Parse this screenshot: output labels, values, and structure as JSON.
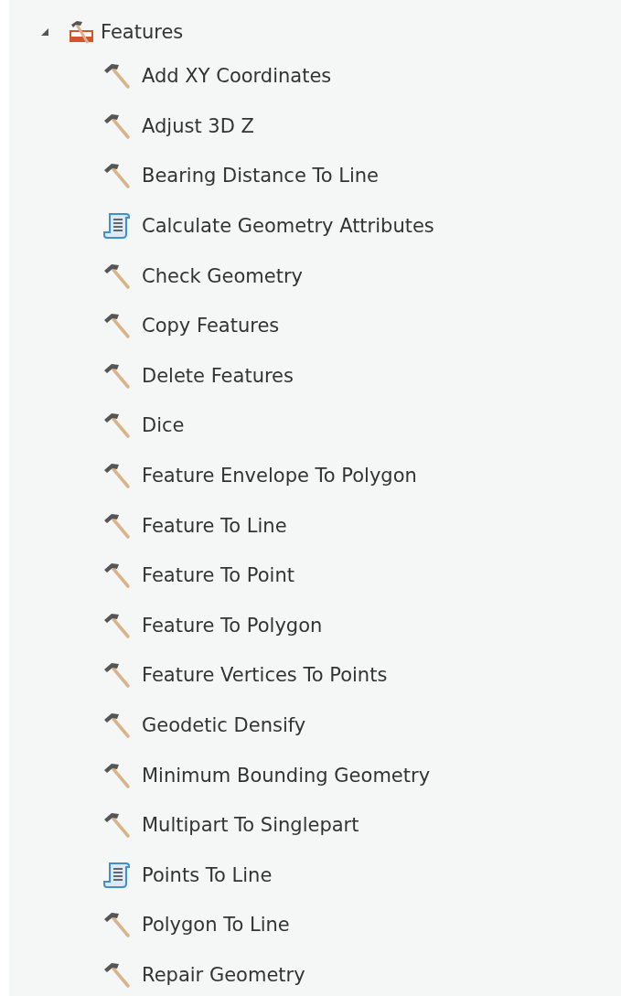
{
  "tree": {
    "label": "Features",
    "expanded": true,
    "children": [
      {
        "label": "Add XY Coordinates",
        "kind": "tool"
      },
      {
        "label": "Adjust 3D Z",
        "kind": "tool"
      },
      {
        "label": "Bearing Distance To Line",
        "kind": "tool"
      },
      {
        "label": "Calculate Geometry Attributes",
        "kind": "script"
      },
      {
        "label": "Check Geometry",
        "kind": "tool"
      },
      {
        "label": "Copy Features",
        "kind": "tool"
      },
      {
        "label": "Delete Features",
        "kind": "tool"
      },
      {
        "label": "Dice",
        "kind": "tool"
      },
      {
        "label": "Feature Envelope To Polygon",
        "kind": "tool"
      },
      {
        "label": "Feature To Line",
        "kind": "tool"
      },
      {
        "label": "Feature To Point",
        "kind": "tool"
      },
      {
        "label": "Feature To Polygon",
        "kind": "tool"
      },
      {
        "label": "Feature Vertices To Points",
        "kind": "tool"
      },
      {
        "label": "Geodetic Densify",
        "kind": "tool"
      },
      {
        "label": "Minimum Bounding Geometry",
        "kind": "tool"
      },
      {
        "label": "Multipart To Singlepart",
        "kind": "tool"
      },
      {
        "label": "Points To Line",
        "kind": "script"
      },
      {
        "label": "Polygon To Line",
        "kind": "tool"
      },
      {
        "label": "Repair Geometry",
        "kind": "tool"
      }
    ]
  }
}
